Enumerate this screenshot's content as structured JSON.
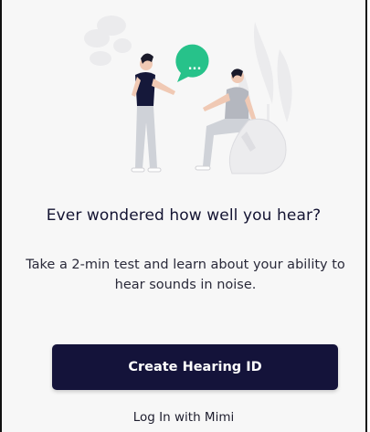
{
  "illustration": {
    "icon": "conversation-illustration",
    "bubble_text": "...",
    "colors": {
      "bubble": "#27c28a",
      "shirt_dark": "#15183a",
      "shirt_grey": "#b4b7bf",
      "pants": "#cfd2d8",
      "skin": "#f0c9b4",
      "hair": "#1a1a2a",
      "foliage": "#e8e8ea"
    }
  },
  "main": {
    "headline": "Ever wondered how well you hear?",
    "subtext": "Take a 2-min test and learn about your ability to hear sounds in noise."
  },
  "actions": {
    "primary_label": "Create Hearing ID",
    "secondary_label": "Log In with Mimi"
  },
  "colors": {
    "primary_button": "#14133a",
    "background": "#f7f7f7",
    "accent": "#27c28a"
  }
}
